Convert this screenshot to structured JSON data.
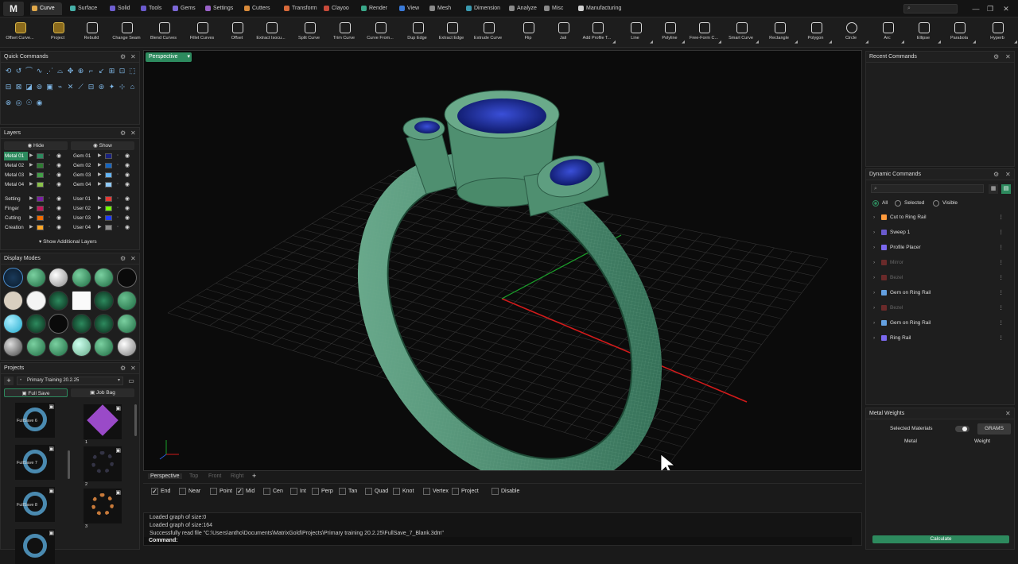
{
  "app": {
    "logo": "M"
  },
  "menu_tabs": [
    {
      "label": "Curve",
      "color": "#e0a84a"
    },
    {
      "label": "Surface",
      "color": "#46b0a8"
    },
    {
      "label": "Solid",
      "color": "#6e5fd0"
    },
    {
      "label": "Tools",
      "color": "#6a5acd"
    },
    {
      "label": "Gems",
      "color": "#7c68d8"
    },
    {
      "label": "Settings",
      "color": "#9a62c8"
    },
    {
      "label": "Cutters",
      "color": "#d88a3a"
    },
    {
      "label": "Transform",
      "color": "#d86a3a"
    },
    {
      "label": "Clayoo",
      "color": "#c84a3a"
    },
    {
      "label": "Render",
      "color": "#3aa88a"
    },
    {
      "label": "View",
      "color": "#3a7ad8"
    },
    {
      "label": "Mesh",
      "color": "#8a8a8a"
    },
    {
      "label": "Dimension",
      "color": "#3a9ab0"
    },
    {
      "label": "Analyze",
      "color": "#8a8a8a"
    },
    {
      "label": "Misc",
      "color": "#8a8a8a"
    },
    {
      "label": "Manufacturing",
      "color": "#d0d0d0"
    }
  ],
  "toolbar": [
    "Offset Curve...",
    "Project",
    "Rebuild",
    "Change Seam",
    "Blend Curves",
    "Fillet Curves",
    "Offset",
    "Extract Isocu...",
    "Split Curve",
    "Trim Curve",
    "Curve From...",
    "Dup Edge",
    "Extract Edge",
    "Extrude Curve",
    "Flip",
    "Jali",
    "Add Profile T...",
    "Line",
    "Polyline",
    "Free-Form C...",
    "Smart Curve",
    "Rectangle",
    "Polygon",
    "Circle",
    "Arc",
    "Ellipse",
    "Parabola",
    "Hyperb"
  ],
  "quick_commands": {
    "title": "Quick Commands"
  },
  "layers": {
    "title": "Layers",
    "hide_label": "Hide",
    "show_label": "Show",
    "left": [
      {
        "name": "Metal 01",
        "color": "#2d8a5e",
        "selected": true
      },
      {
        "name": "Metal 02",
        "color": "#2e7d32"
      },
      {
        "name": "Metal 03",
        "color": "#43a047"
      },
      {
        "name": "Metal 04",
        "color": "#8bc34a"
      },
      {
        "name": "Setting",
        "color": "#7b1fa2"
      },
      {
        "name": "Finger",
        "color": "#c2185b"
      },
      {
        "name": "Cutting",
        "color": "#ef6c00"
      },
      {
        "name": "Creation",
        "color": "#ffa726"
      }
    ],
    "right": [
      {
        "name": "Gem 01",
        "color": "#1a237e"
      },
      {
        "name": "Gem 02",
        "color": "#1565c0"
      },
      {
        "name": "Gem 03",
        "color": "#64b5f6"
      },
      {
        "name": "Gem 04",
        "color": "#90caf9"
      },
      {
        "name": "User 01",
        "color": "#e53935"
      },
      {
        "name": "User 02",
        "color": "#76ff03"
      },
      {
        "name": "User 03",
        "color": "#1e3cff"
      },
      {
        "name": "User 04",
        "color": "#8d8d8d"
      }
    ],
    "show_additional": "Show Additional Layers"
  },
  "display_modes": {
    "title": "Display Modes"
  },
  "projects": {
    "title": "Projects",
    "project_name": "Primary Training 20.2.25",
    "full_save_label": "Full Save",
    "job_bag_label": "Job Bag",
    "thumbs_left": [
      "FullSave 6",
      "FullSave 7",
      "FullSave 8",
      ""
    ],
    "thumbs_right": [
      "1",
      "2",
      "3"
    ]
  },
  "viewport": {
    "active_view": "Perspective",
    "view_tabs": [
      "Perspective",
      "Top",
      "Front",
      "Right"
    ],
    "add_tab": "+"
  },
  "osnaps": [
    {
      "label": "End",
      "checked": true
    },
    {
      "label": "Near",
      "checked": false
    },
    {
      "label": "Point",
      "checked": false
    },
    {
      "label": "Mid",
      "checked": true
    },
    {
      "label": "Cen",
      "checked": false
    },
    {
      "label": "Int",
      "checked": false
    },
    {
      "label": "Perp",
      "checked": false
    },
    {
      "label": "Tan",
      "checked": false
    },
    {
      "label": "Quad",
      "checked": false
    },
    {
      "label": "Knot",
      "checked": false
    },
    {
      "label": "Vertex",
      "checked": false
    },
    {
      "label": "Project",
      "checked": false
    },
    {
      "label": "Disable",
      "checked": false
    }
  ],
  "command_log": [
    "Loaded graph of size:0",
    "Loaded graph of size:164",
    "Successfully read file \"C:\\Users\\antho\\Documents\\MatrixGold\\Projects\\Primary training 20.2.25\\FullSave_7_Blank.3dm\""
  ],
  "command_prompt": "Command:",
  "recent_commands": {
    "title": "Recent Commands"
  },
  "dynamic_commands": {
    "title": "Dynamic Commands",
    "filters": [
      "All",
      "Selected",
      "Visible"
    ],
    "items": [
      {
        "name": "Cut to Ring Rail",
        "color": "#ff9a3c",
        "dim": false
      },
      {
        "name": "Sweep 1",
        "color": "#6a5acd",
        "dim": false
      },
      {
        "name": "Profile Placer",
        "color": "#7b68ee",
        "dim": false
      },
      {
        "name": "Mirror",
        "color": "#6a2a2a",
        "dim": true
      },
      {
        "name": "Bezel",
        "color": "#6a2a2a",
        "dim": true
      },
      {
        "name": "Gem on Ring Rail",
        "color": "#64a0e0",
        "dim": false
      },
      {
        "name": "Bezel",
        "color": "#6a2a2a",
        "dim": true
      },
      {
        "name": "Gem on Ring Rail",
        "color": "#64a0e0",
        "dim": false
      },
      {
        "name": "Ring Rail",
        "color": "#7b68ee",
        "dim": false
      }
    ]
  },
  "metal_weights": {
    "title": "Metal Weights",
    "selected_materials": "Selected Materials",
    "units_button": "GRAMS",
    "col_metal": "Metal",
    "col_weight": "Weight",
    "calculate": "Calculate"
  },
  "accent_color": "#2d8a5e"
}
